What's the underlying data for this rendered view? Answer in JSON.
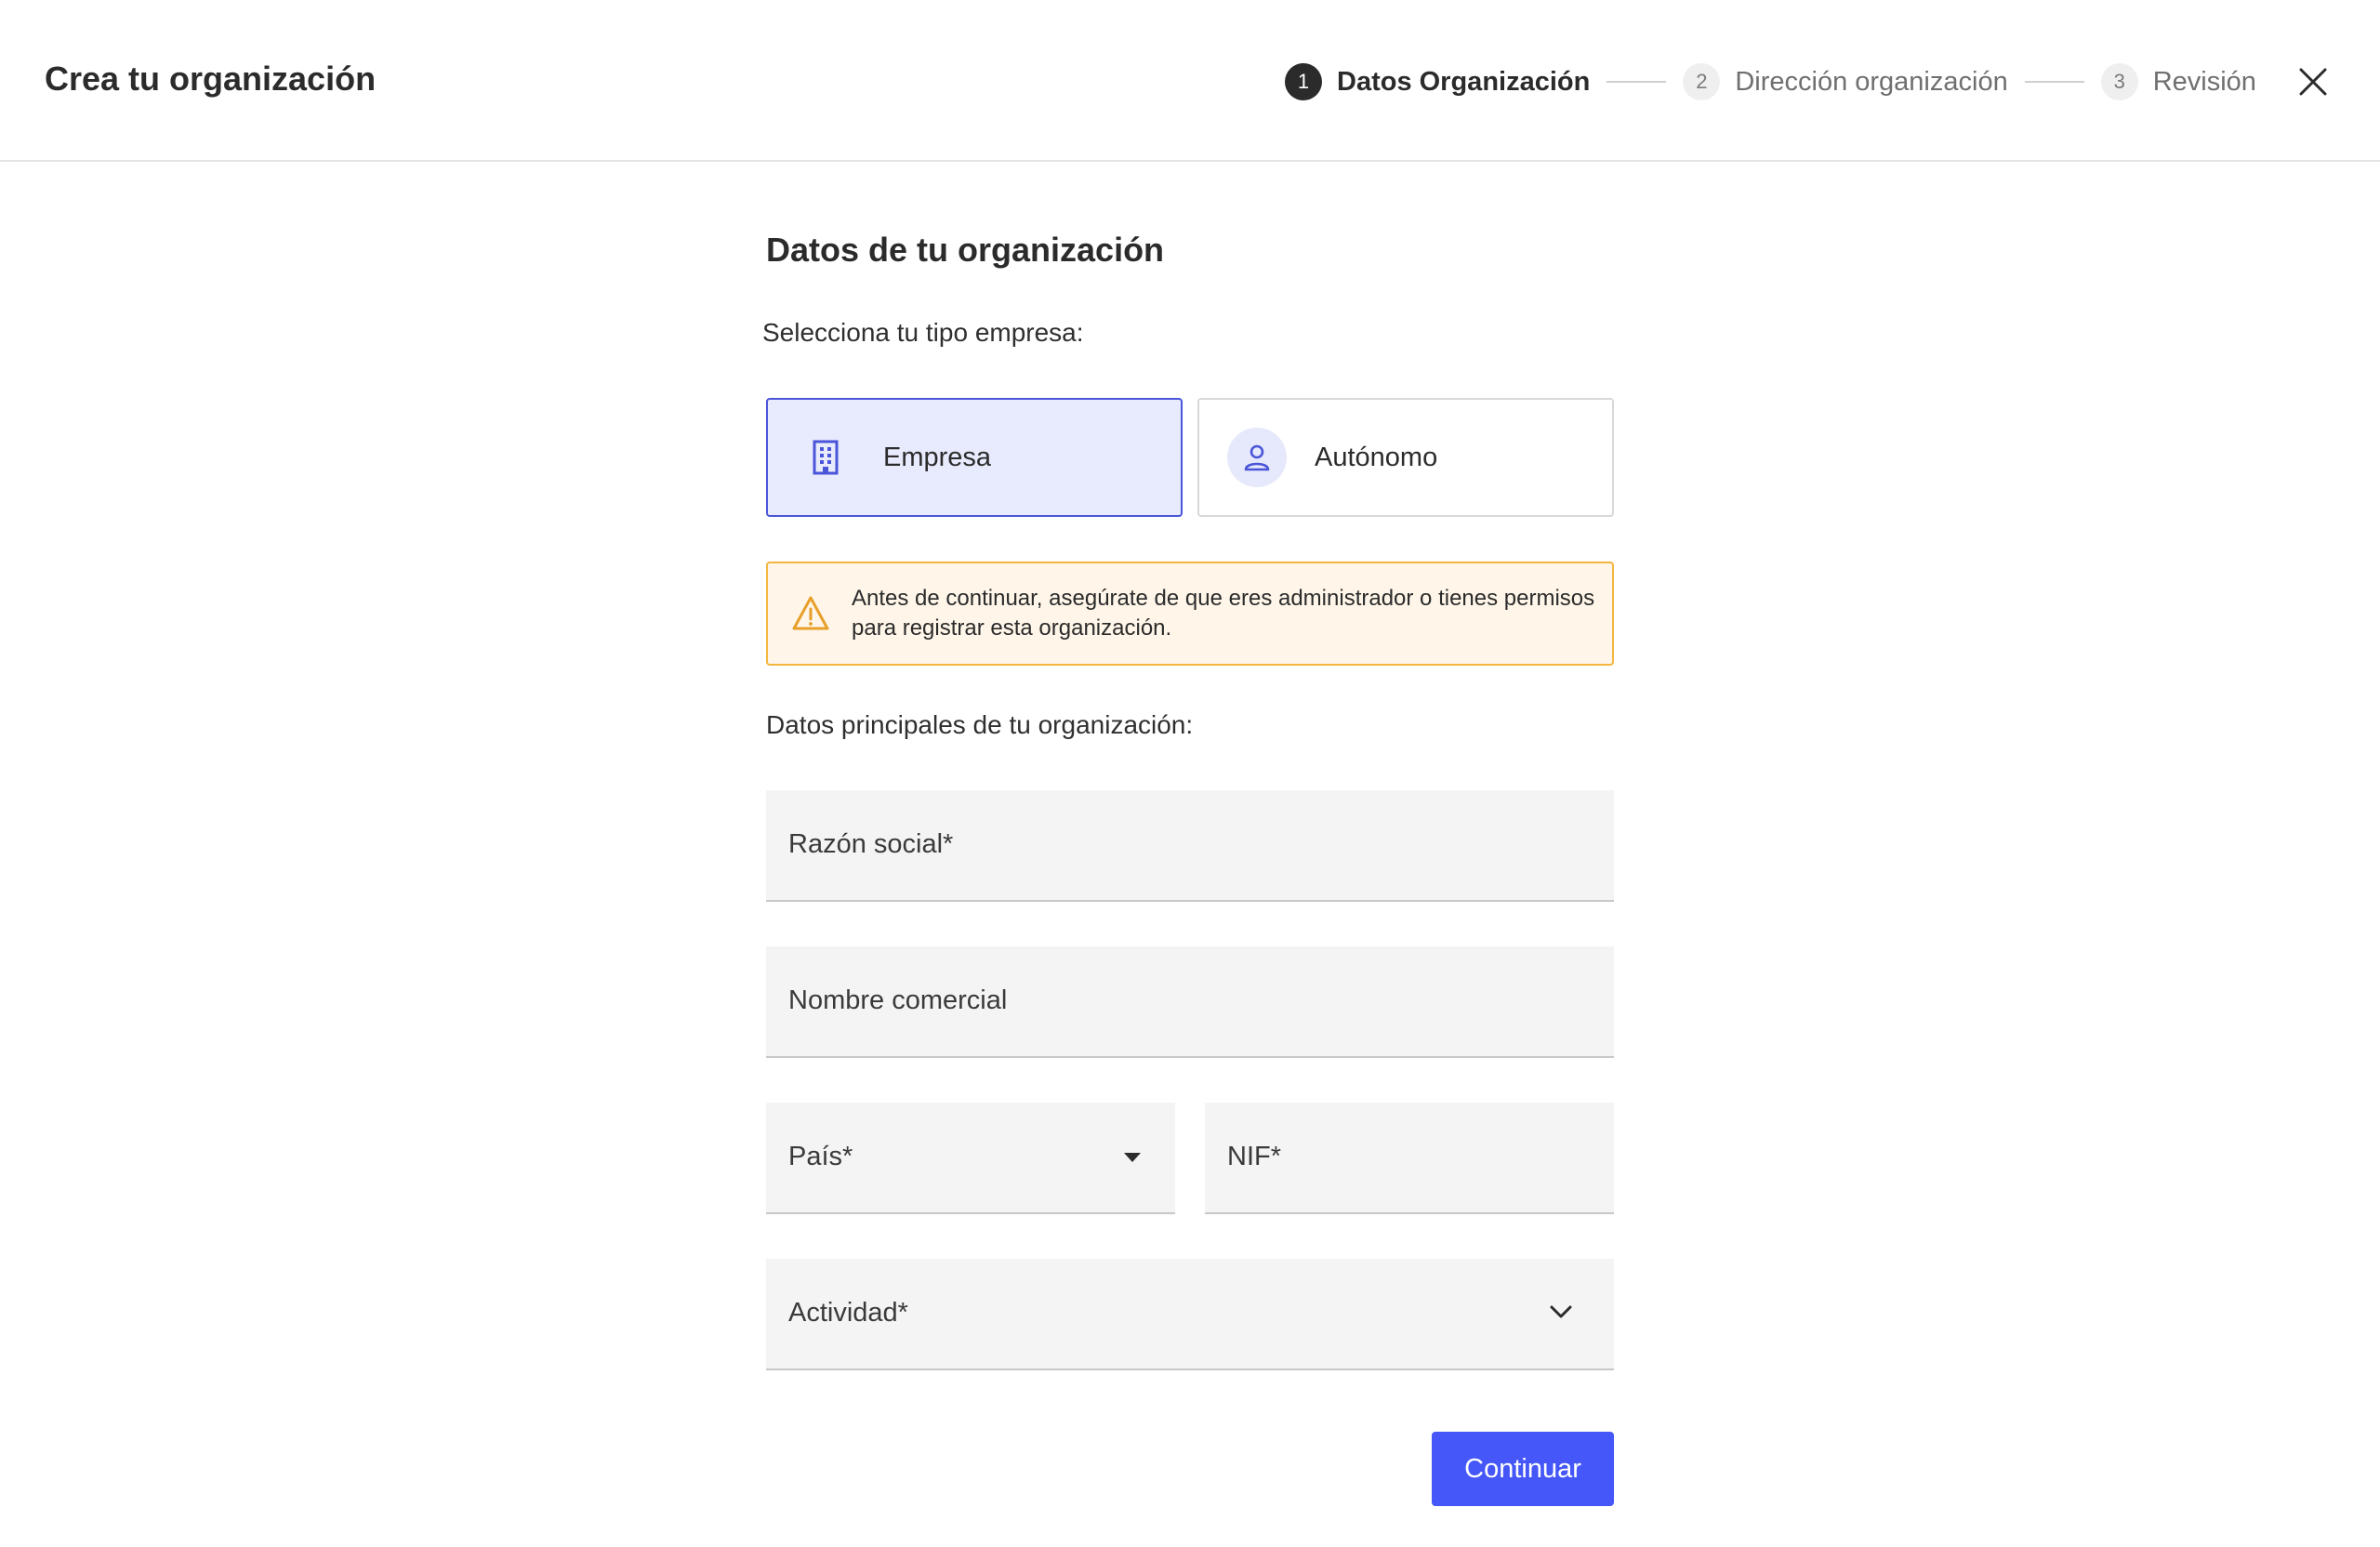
{
  "header": {
    "title": "Crea tu organización",
    "steps": [
      {
        "number": "1",
        "label": "Datos Organización",
        "state": "active"
      },
      {
        "number": "2",
        "label": "Dirección organización",
        "state": "pending"
      },
      {
        "number": "3",
        "label": "Revisión",
        "state": "pending"
      }
    ],
    "close_icon": "close-icon"
  },
  "form": {
    "section_title": "Datos de tu organización",
    "type_prompt": "Selecciona tu tipo empresa:",
    "types": [
      {
        "label": "Empresa",
        "icon": "building-icon",
        "selected": true
      },
      {
        "label": "Autónomo",
        "icon": "user-icon",
        "selected": false
      }
    ],
    "warning": {
      "icon": "warning-icon",
      "text": "Antes de continuar, asegúrate de que eres administrador o tienes permisos para registrar esta organización."
    },
    "main_prompt": "Datos principales de tu organización:",
    "fields": {
      "razon_social": "Razón social*",
      "nombre_comercial": "Nombre comercial",
      "pais": "País*",
      "nif": "NIF*",
      "actividad": "Actividad*"
    },
    "submit_label": "Continuar"
  },
  "colors": {
    "accent": "#4557f8",
    "selected_card_bg": "#e8ebfd",
    "selected_card_border": "#4a55d8",
    "warning_bg": "#fff6e9",
    "warning_border": "#f3b63f",
    "field_bg": "#f4f4f4"
  }
}
